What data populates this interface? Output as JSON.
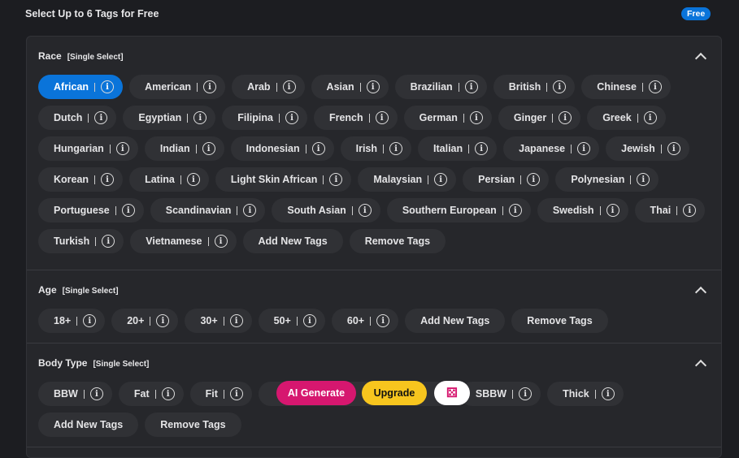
{
  "header": {
    "title": "Select Up to 6 Tags for Free",
    "badge": "Free"
  },
  "sections": [
    {
      "title": "Race",
      "mode": "[Single Select]",
      "selected": "African",
      "chips": [
        "African",
        "American",
        "Arab",
        "Asian",
        "Brazilian",
        "British",
        "Chinese",
        "Dutch",
        "Egyptian",
        "Filipina",
        "French",
        "German",
        "Ginger",
        "Greek",
        "Hungarian",
        "Indian",
        "Indonesian",
        "Irish",
        "Italian",
        "Japanese",
        "Jewish",
        "Korean",
        "Latina",
        "Light Skin African",
        "Malaysian",
        "Persian",
        "Polynesian",
        "Portuguese",
        "Scandinavian",
        "South Asian",
        "Southern European",
        "Swedish",
        "Thai",
        "Turkish",
        "Vietnamese"
      ]
    },
    {
      "title": "Age",
      "mode": "[Single Select]",
      "chips": [
        "18+",
        "20+",
        "30+",
        "50+",
        "60+"
      ]
    },
    {
      "title": "Body Type",
      "mode": "[Single Select]",
      "chips": [
        "BBW",
        "Fat",
        "Fit",
        "",
        "SBBW",
        "Thick"
      ]
    }
  ],
  "actions": {
    "add": "Add New Tags",
    "remove": "Remove Tags",
    "ai_generate": "AI Generate",
    "upgrade": "Upgrade",
    "random_icon": "dice-icon"
  },
  "colors": {
    "selected": "#0a74da",
    "ai": "#d6176f",
    "upgrade": "#f7c51e"
  }
}
